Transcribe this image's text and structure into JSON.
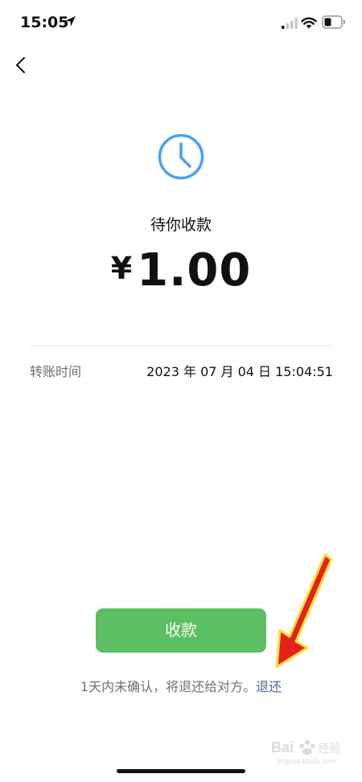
{
  "status_bar": {
    "time": "15:05"
  },
  "transfer": {
    "status_text": "待你收款",
    "currency_symbol": "¥",
    "amount": "1.00",
    "detail_label": "转账时间",
    "detail_value": "2023 年 07 月 04 日 15:04:51"
  },
  "actions": {
    "confirm_label": "收款",
    "note_prefix": "1天内未确认，将退还给对方。",
    "return_link": "退还"
  },
  "icons": {
    "back": "chevron-left-icon",
    "clock": "clock-icon",
    "location": "location-arrow-icon",
    "signal": "cellular-signal-icon",
    "wifi": "wifi-icon",
    "battery": "battery-icon"
  },
  "colors": {
    "accent_green": "#5cbf64",
    "clock_blue": "#4aa3ef",
    "link_blue": "#4a6895",
    "annotation_red": "#e8201a",
    "annotation_yellow": "#f5e23a"
  },
  "watermark_logo_text": "Bai经验 jingyan.baidu.com"
}
